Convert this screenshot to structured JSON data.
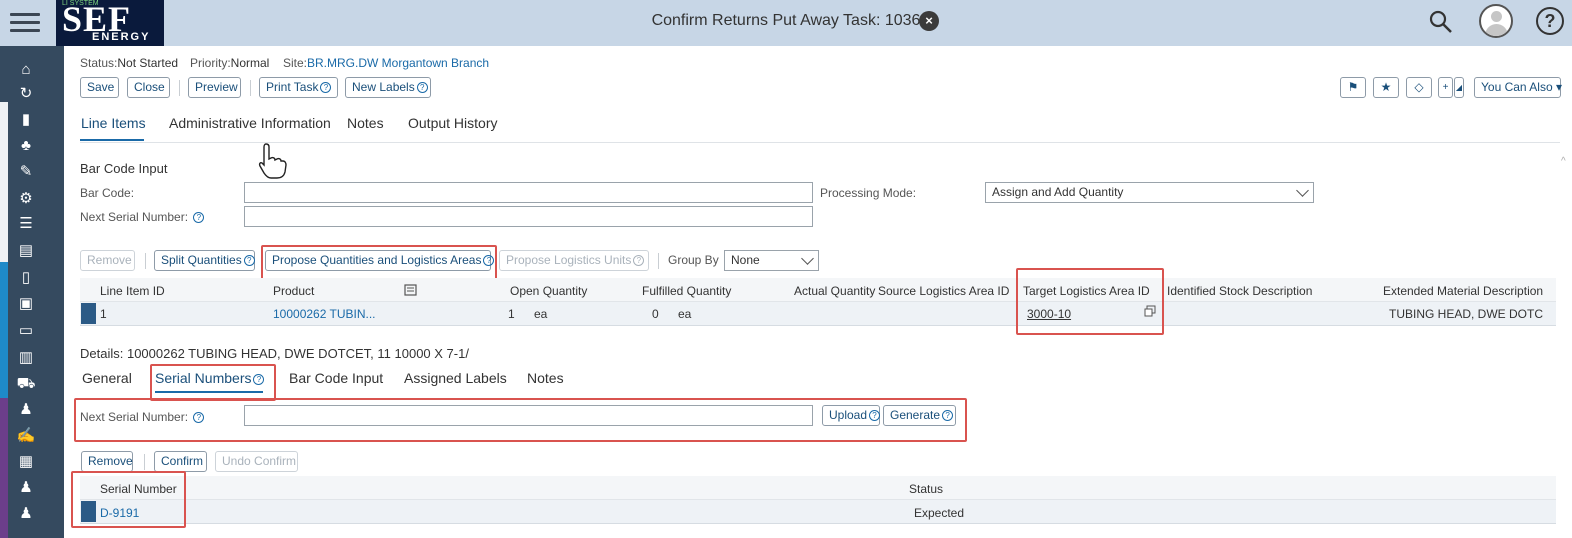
{
  "shell": {
    "logo_text": "SEF",
    "logo_subtext": "ENERGY",
    "logo_tag": "LI SYSTEM",
    "title": "Confirm Returns Put Away Task: 1036"
  },
  "header": {
    "status_label": "Status:",
    "status_value": "Not Started",
    "priority_label": "Priority:",
    "priority_value": "Normal",
    "site_label": "Site:",
    "site_value": "BR.MRG.DW Morgantown Branch"
  },
  "toolbar": {
    "save": "Save",
    "close": "Close",
    "preview": "Preview",
    "print_task": "Print Task",
    "new_labels": "New Labels",
    "you_can_also": "You Can Also"
  },
  "tabs": [
    "Line Items",
    "Administrative Information",
    "Notes",
    "Output History"
  ],
  "barcode_section": {
    "title": "Bar Code Input",
    "bar_code_label": "Bar Code:",
    "next_serial_label": "Next Serial Number:",
    "processing_mode_label": "Processing Mode:",
    "processing_mode_value": "Assign and Add Quantity"
  },
  "line_toolbar": {
    "remove": "Remove",
    "split_quantities": "Split Quantities",
    "propose_quantities": "Propose Quantities and Logistics Areas",
    "propose_logistics_units": "Propose Logistics Units",
    "group_by_label": "Group By",
    "group_by_value": "None"
  },
  "line_table": {
    "columns": [
      "Line Item ID",
      "Product",
      "Open Quantity",
      "Fulfilled Quantity",
      "Actual Quantity",
      "Source Logistics Area ID",
      "Target Logistics Area ID",
      "Identified Stock Description",
      "Extended Material Description"
    ],
    "row": {
      "line_item_id": "1",
      "product": "10000262 TUBIN...",
      "open_qty": "1",
      "open_unit": "ea",
      "fulfilled_qty": "0",
      "fulfilled_unit": "ea",
      "target_area": "3000-10",
      "extended_desc": "TUBING HEAD, DWE DOTC"
    }
  },
  "details": {
    "title": "Details: 10000262 TUBING HEAD, DWE DOTCET, 11 10000 X 7-1/",
    "tabs": [
      "General",
      "Serial Numbers",
      "Bar Code Input",
      "Assigned Labels",
      "Notes"
    ],
    "next_serial_label": "Next Serial Number:",
    "upload": "Upload",
    "generate": "Generate",
    "remove": "Remove",
    "confirm": "Confirm",
    "undo_confirm": "Undo Confirm",
    "columns": [
      "Serial Number",
      "Status"
    ],
    "row": {
      "serial": "D-9191",
      "status": "Expected"
    }
  }
}
